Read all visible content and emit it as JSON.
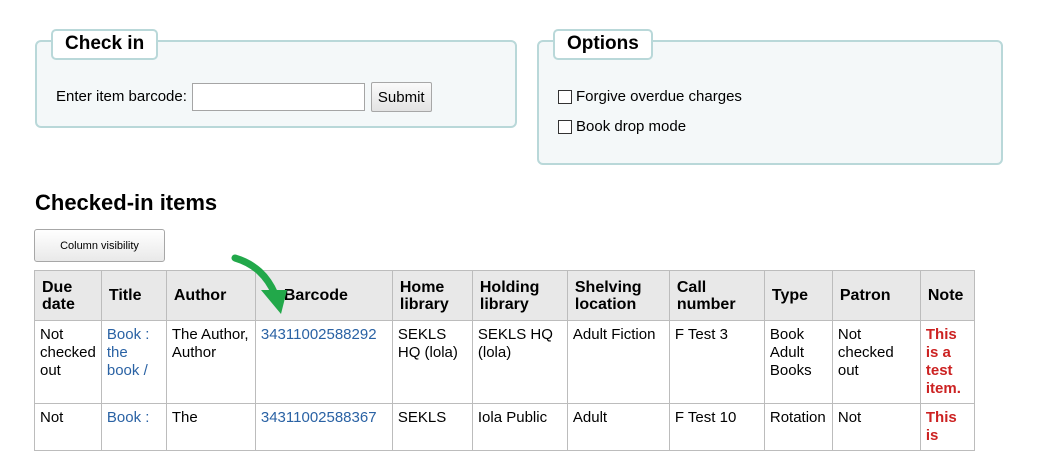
{
  "checkin": {
    "legend": "Check in",
    "label": "Enter item barcode:",
    "input_value": "",
    "submit_label": "Submit"
  },
  "options": {
    "legend": "Options",
    "forgive_label": "Forgive overdue charges",
    "bookdrop_label": "Book drop mode"
  },
  "section_title": "Checked-in items",
  "column_visibility_label": "Column visibility",
  "table": {
    "headers": [
      "Due date",
      "Title",
      "Author",
      "Barcode",
      "Home library",
      "Holding library",
      "Shelving location",
      "Call number",
      "Type",
      "Patron",
      "Note"
    ],
    "rows": [
      {
        "due": "Not checked out",
        "title": "Book : the book /",
        "author": "The Author, Author",
        "barcode": "34311002588292",
        "home": "SEKLS HQ (lola)",
        "holding": "SEKLS HQ (lola)",
        "shelving": "Adult Fiction",
        "call": "F Test 3",
        "type": "Book Adult Books",
        "patron": "Not checked out",
        "note": "This is a test item."
      },
      {
        "due": "Not",
        "title": "Book :",
        "author": "The",
        "barcode": "34311002588367",
        "home": "SEKLS",
        "holding": "Iola Public",
        "shelving": "Adult",
        "call": "F Test 10",
        "type": "Rotation",
        "patron": "Not",
        "note": "This is"
      }
    ]
  },
  "colors": {
    "fieldset_border": "#b9d8d9",
    "fieldset_bg": "#f4f8f9",
    "link": "#2a62a4",
    "note": "#cc2222",
    "arrow": "#22a84a"
  },
  "annotation_icon": "green-curved-arrow-icon"
}
